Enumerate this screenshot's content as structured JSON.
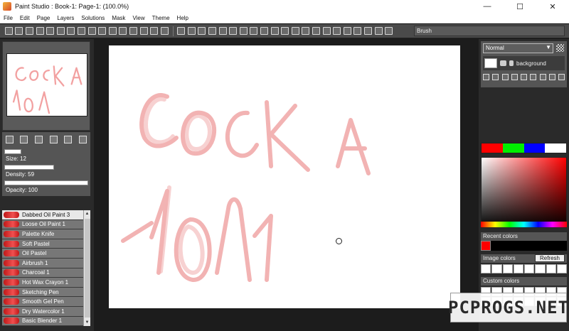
{
  "window": {
    "title": "Paint Studio : Book-1: Page-1:  (100.0%)",
    "minimize": "—",
    "maximize": "☐",
    "close": "✕"
  },
  "menu": [
    "File",
    "Edit",
    "Page",
    "Layers",
    "Solutions",
    "Mask",
    "View",
    "Theme",
    "Help"
  ],
  "toolbar": {
    "brush_label": "Brush"
  },
  "brush_settings": {
    "size_label": "Size: 12",
    "density_label": "Density: 59",
    "opacity_label": "Opacity: 100",
    "size": 12,
    "density": 59,
    "opacity": 100
  },
  "brushes": [
    "Dabbed Oil Paint 3",
    "Loose Oil Paint 1",
    "Palette Knife",
    "Soft Pastel",
    "Oil Pastel",
    "Airbrush 1",
    "Charcoal 1",
    "Hot Wax Crayon 1",
    "Sketching Pen",
    "Smooth Gel Pen",
    "Dry Watercolor 1",
    "Basic Blender 1"
  ],
  "selected_brush": "Dabbed Oil Paint 3",
  "layers": {
    "blend_mode": "Normal",
    "items": [
      {
        "name": "background"
      }
    ]
  },
  "colors": {
    "swatches": [
      "#ff0000",
      "#00ee00",
      "#0000ff",
      "#ffffff"
    ],
    "recent_label": "Recent colors",
    "image_label": "Image colors",
    "refresh_label": "Refresh",
    "custom_label": "Custom colors",
    "recent": [
      "#ff0000"
    ]
  },
  "watermark": "PCPROGS.NET"
}
